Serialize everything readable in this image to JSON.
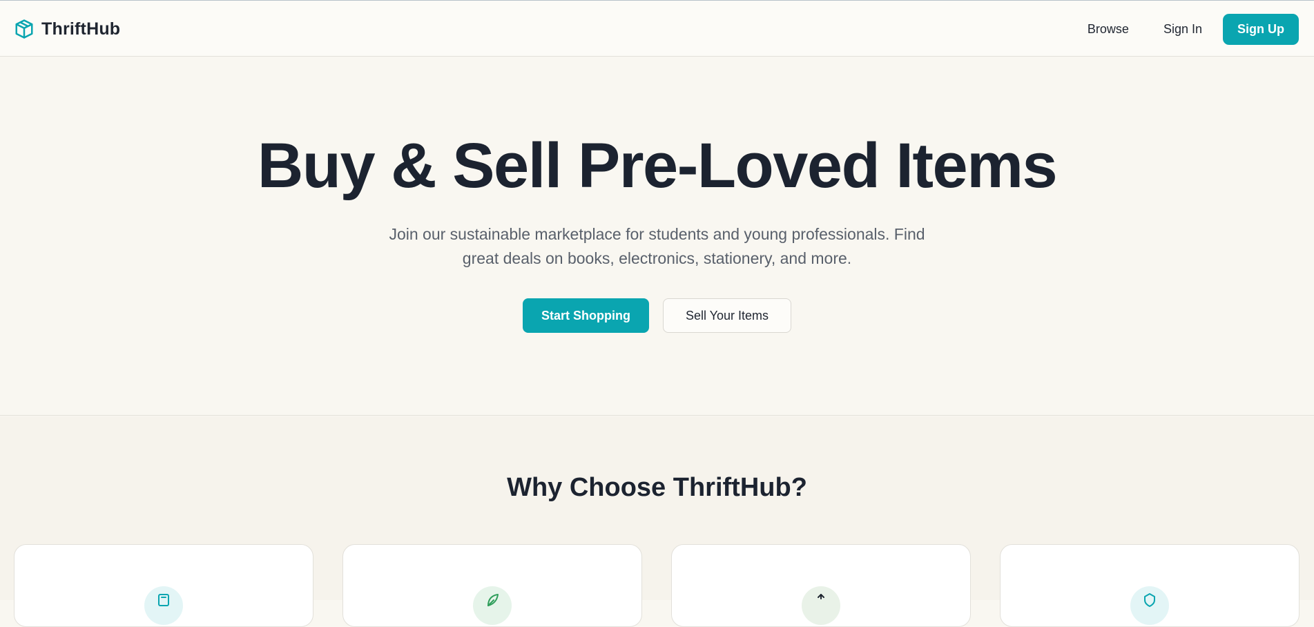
{
  "brand": {
    "name": "ThriftHub",
    "icon": "package-box-icon",
    "accent_color": "#0aa5b0"
  },
  "nav": {
    "browse_label": "Browse",
    "signin_label": "Sign In",
    "signup_label": "Sign Up"
  },
  "hero": {
    "title": "Buy & Sell Pre-Loved Items",
    "subtitle": "Join our sustainable marketplace for students and young professionals. Find great deals on books, electronics, stationery, and more.",
    "primary_cta": "Start Shopping",
    "secondary_cta": "Sell Your Items"
  },
  "features": {
    "title": "Why Choose ThriftHub?",
    "cards": [
      {
        "icon": "tag-icon",
        "icon_bg": "#e3f5f6",
        "icon_color": "#0aa5b0"
      },
      {
        "icon": "leaf-icon",
        "icon_bg": "#e6f4ea",
        "icon_color": "#2f9e5b"
      },
      {
        "icon": "users-icon",
        "icon_bg": "#e9f2e8",
        "icon_color": "#1f2530"
      },
      {
        "icon": "shield-icon",
        "icon_bg": "#e3f5f6",
        "icon_color": "#0aa5b0"
      }
    ]
  }
}
